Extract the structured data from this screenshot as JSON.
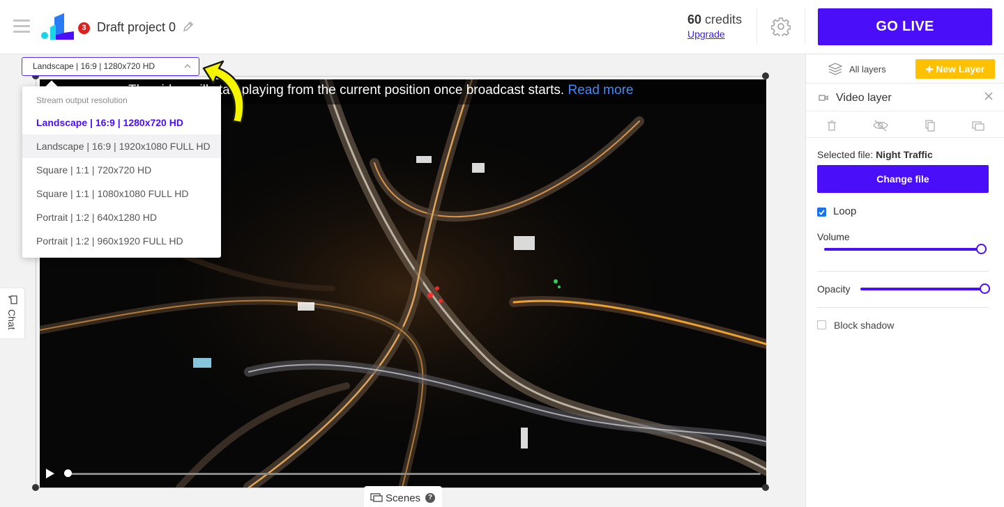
{
  "header": {
    "notification_count": "3",
    "project_title": "Draft project 0",
    "credits_value": "60",
    "credits_label": "credits",
    "upgrade_label": "Upgrade",
    "go_live_label": "GO LIVE"
  },
  "canvas": {
    "resolution_selected": "Landscape | 16:9 | 1280x720 HD",
    "notice_text": "The video will start playing from the current position once broadcast starts.",
    "notice_link": "Read more",
    "progress": 0,
    "chat_label": "Chat",
    "scenes_label": "Scenes",
    "help_glyph": "?"
  },
  "resolution_dropdown": {
    "header": "Stream output resolution",
    "options": [
      {
        "label": "Landscape | 16:9 | 1280x720 HD",
        "selected": true
      },
      {
        "label": "Landscape | 16:9 | 1920x1080 FULL HD",
        "selected": false
      },
      {
        "label": "Square | 1:1 | 720x720 HD",
        "selected": false
      },
      {
        "label": "Square | 1:1 | 1080x1080 FULL HD",
        "selected": false
      },
      {
        "label": "Portrait | 1:2 | 640x1280 HD",
        "selected": false
      },
      {
        "label": "Portrait | 1:2 | 960x1920 FULL HD",
        "selected": false
      }
    ]
  },
  "right_panel": {
    "all_layers_label": "All layers",
    "new_layer_label": "New Layer",
    "layer_title": "Video layer",
    "selected_file_prefix": "Selected file:",
    "selected_file_name": "Night Traffic",
    "change_file_label": "Change file",
    "loop_label": "Loop",
    "loop_checked": true,
    "volume_label": "Volume",
    "volume_value": 1.0,
    "opacity_label": "Opacity",
    "opacity_value": 1.0,
    "block_shadow_label": "Block shadow",
    "block_shadow_checked": false
  },
  "colors": {
    "accent": "#4a0ff8",
    "new_layer": "#ffc000",
    "badge": "#e02020",
    "link": "#3d8bff",
    "annotation_arrow": "#f5f500"
  },
  "icons": {
    "menu": "hamburger-icon",
    "edit": "pencil-icon",
    "settings": "gear-icon",
    "layers": "layers-icon",
    "camera": "video-camera-icon",
    "close": "close-icon",
    "trash": "trash-icon",
    "visibility": "eye-off-icon",
    "duplicate": "copy-icon",
    "scenes": "monitor-icon",
    "chat": "chat-icon",
    "play": "play-icon"
  }
}
